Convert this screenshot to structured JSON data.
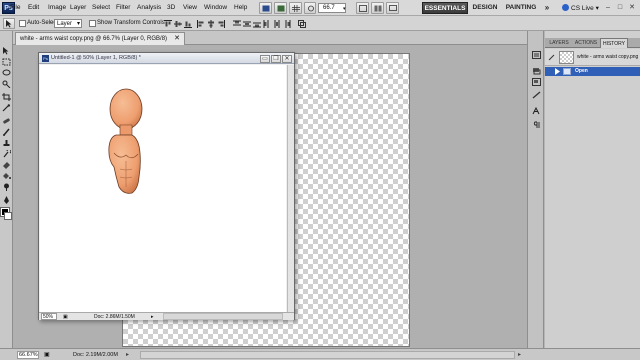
{
  "app": {
    "logo": "Ps",
    "menus": [
      "File",
      "Edit",
      "Image",
      "Layer",
      "Select",
      "Filter",
      "Analysis",
      "3D",
      "View",
      "Window",
      "Help"
    ],
    "zoom_value": "66.7",
    "workspaces": {
      "active": "ESSENTIALS",
      "design": "DESIGN",
      "painting": "PAINTING",
      "more": "»"
    },
    "cslive": "CS Live ▾",
    "window_controls": [
      "–",
      "□",
      "✕"
    ]
  },
  "options_bar": {
    "auto_select_label": "Auto-Select:",
    "auto_select_value": "Layer",
    "show_transform_label": "Show Transform Controls"
  },
  "document_tab": {
    "title": "white - arms waist copy.png @ 66.7% (Layer 0, RGB/8)",
    "close": "✕"
  },
  "floating_window": {
    "title": "Untitled-1 @ 50% (Layer 1, RGB/8) *",
    "controls": [
      "▭",
      "❐",
      "✕"
    ],
    "zoom": "50%",
    "doc_info": "Doc: 2.86M/1.50M"
  },
  "panel": {
    "tabs": [
      "LAYERS",
      "ACTIONS",
      "HISTORY"
    ],
    "active_tab": "HISTORY",
    "snapshot_name": "white - arms waist copy.png",
    "states": [
      "Open"
    ]
  },
  "status_bar": {
    "zoom": "66.67%",
    "doc_info": "Doc: 2.19M/2.00M"
  },
  "colors": {
    "foreground": "#000000",
    "background": "#ffffff",
    "history_selected": "#2f5fb6",
    "skin": "#f0a676"
  }
}
